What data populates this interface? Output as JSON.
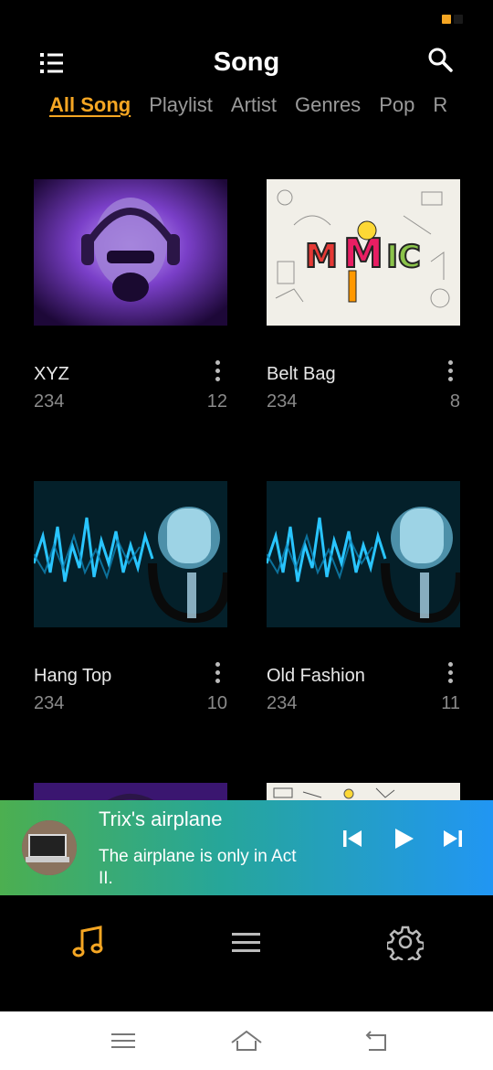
{
  "header": {
    "title": "Song"
  },
  "tabs": [
    {
      "label": "All Song",
      "active": true
    },
    {
      "label": "Playlist",
      "active": false
    },
    {
      "label": "Artist",
      "active": false
    },
    {
      "label": "Genres",
      "active": false
    },
    {
      "label": "Pop",
      "active": false
    },
    {
      "label": "R",
      "active": false
    }
  ],
  "songs": [
    {
      "title": "XYZ",
      "count": "234",
      "num": "12"
    },
    {
      "title": "Belt Bag",
      "count": "234",
      "num": "8"
    },
    {
      "title": "Hang Top",
      "count": "234",
      "num": "10"
    },
    {
      "title": "Old Fashion",
      "count": "234",
      "num": "11"
    }
  ],
  "now_playing": {
    "title": "Trix's airplane",
    "subtitle": "The airplane is only in Act II."
  },
  "colors": {
    "accent": "#f5a623",
    "bar_start": "#4caf50",
    "bar_end": "#2196f3"
  }
}
